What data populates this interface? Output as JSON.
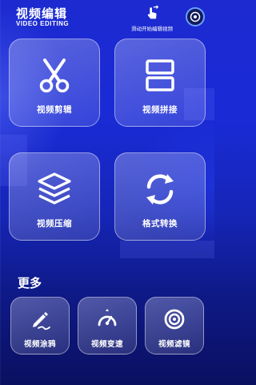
{
  "header": {
    "title": "视频编辑",
    "subtitle": "VIDEO EDITING",
    "swipe_hint": "滑动开始编辑视频"
  },
  "tools": [
    {
      "label": "视频剪辑",
      "icon": "scissors-icon"
    },
    {
      "label": "视频拼接",
      "icon": "split-rectangles-icon"
    },
    {
      "label": "视频压缩",
      "icon": "layers-icon"
    },
    {
      "label": "格式转换",
      "icon": "refresh-arrows-icon"
    }
  ],
  "more": {
    "title": "更多",
    "items": [
      {
        "label": "视频涂鸦",
        "icon": "pen-icon"
      },
      {
        "label": "视频变速",
        "icon": "speedometer-icon"
      },
      {
        "label": "视频滤镜",
        "icon": "camera-lens-icon"
      }
    ]
  },
  "colors": {
    "background_top": "#1c2ad0",
    "background_bottom": "#0a1060",
    "card_border": "#ffffff",
    "profile_ring": "#6aa0ff"
  }
}
